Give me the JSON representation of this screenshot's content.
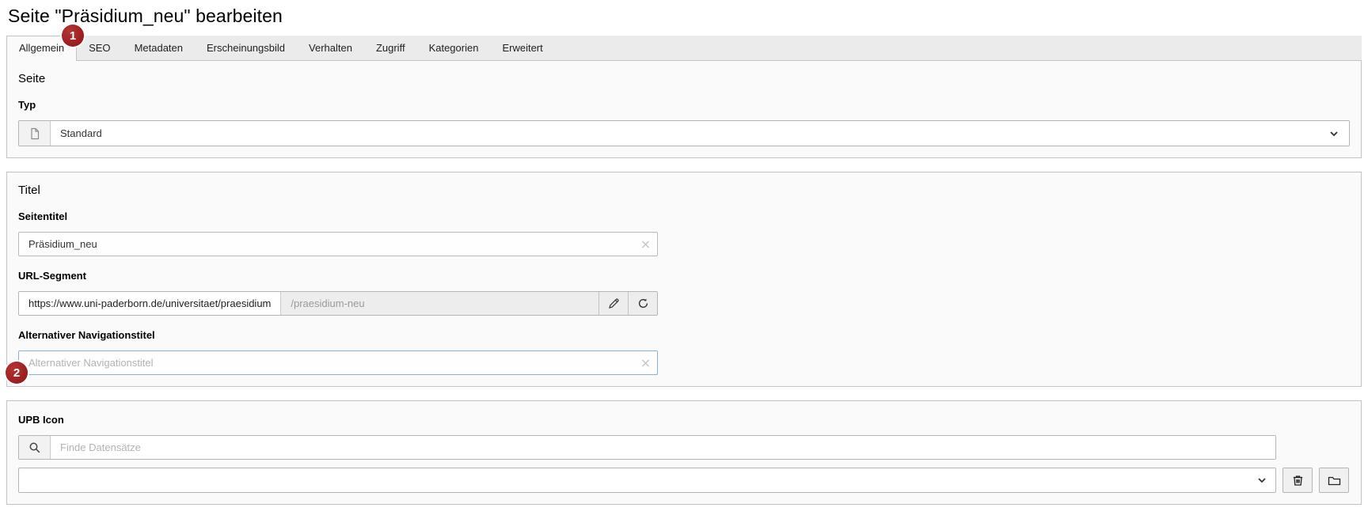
{
  "page": {
    "title": "Seite \"Präsidium_neu\" bearbeiten"
  },
  "tabs": [
    {
      "label": "Allgemein",
      "active": true
    },
    {
      "label": "SEO",
      "active": false
    },
    {
      "label": "Metadaten",
      "active": false
    },
    {
      "label": "Erscheinungsbild",
      "active": false
    },
    {
      "label": "Verhalten",
      "active": false
    },
    {
      "label": "Zugriff",
      "active": false
    },
    {
      "label": "Kategorien",
      "active": false
    },
    {
      "label": "Erweitert",
      "active": false
    }
  ],
  "annotations": [
    {
      "number": "1"
    },
    {
      "number": "2"
    }
  ],
  "sections": {
    "seite": {
      "heading": "Seite",
      "type_label": "Typ",
      "type_value": "Standard"
    },
    "titel": {
      "heading": "Titel",
      "seitentitel_label": "Seitentitel",
      "seitentitel_value": "Präsidium_neu",
      "url_label": "URL-Segment",
      "url_prefix": "https://www.uni-paderborn.de/universitaet/praesidium",
      "url_value": "/praesidium-neu",
      "altnav_label": "Alternativer Navigationstitel",
      "altnav_placeholder": "Alternativer Navigationstitel"
    },
    "upb": {
      "label": "UPB Icon",
      "search_placeholder": "Finde Datensätze"
    }
  },
  "icons": {
    "page_type": "document-icon",
    "clear": "clear-x-icon",
    "slug_edit": "edit-pencil-icon",
    "slug_refresh": "refresh-icon",
    "search": "search-icon",
    "dropdown": "chevron-down-icon",
    "delete": "trash-icon",
    "browse": "folder-icon"
  },
  "colors": {
    "badge_red": "#9b1c1c",
    "focus_border": "#87b1dd",
    "panel_border": "#c3c3c3",
    "panel_bg": "#fafafa"
  }
}
